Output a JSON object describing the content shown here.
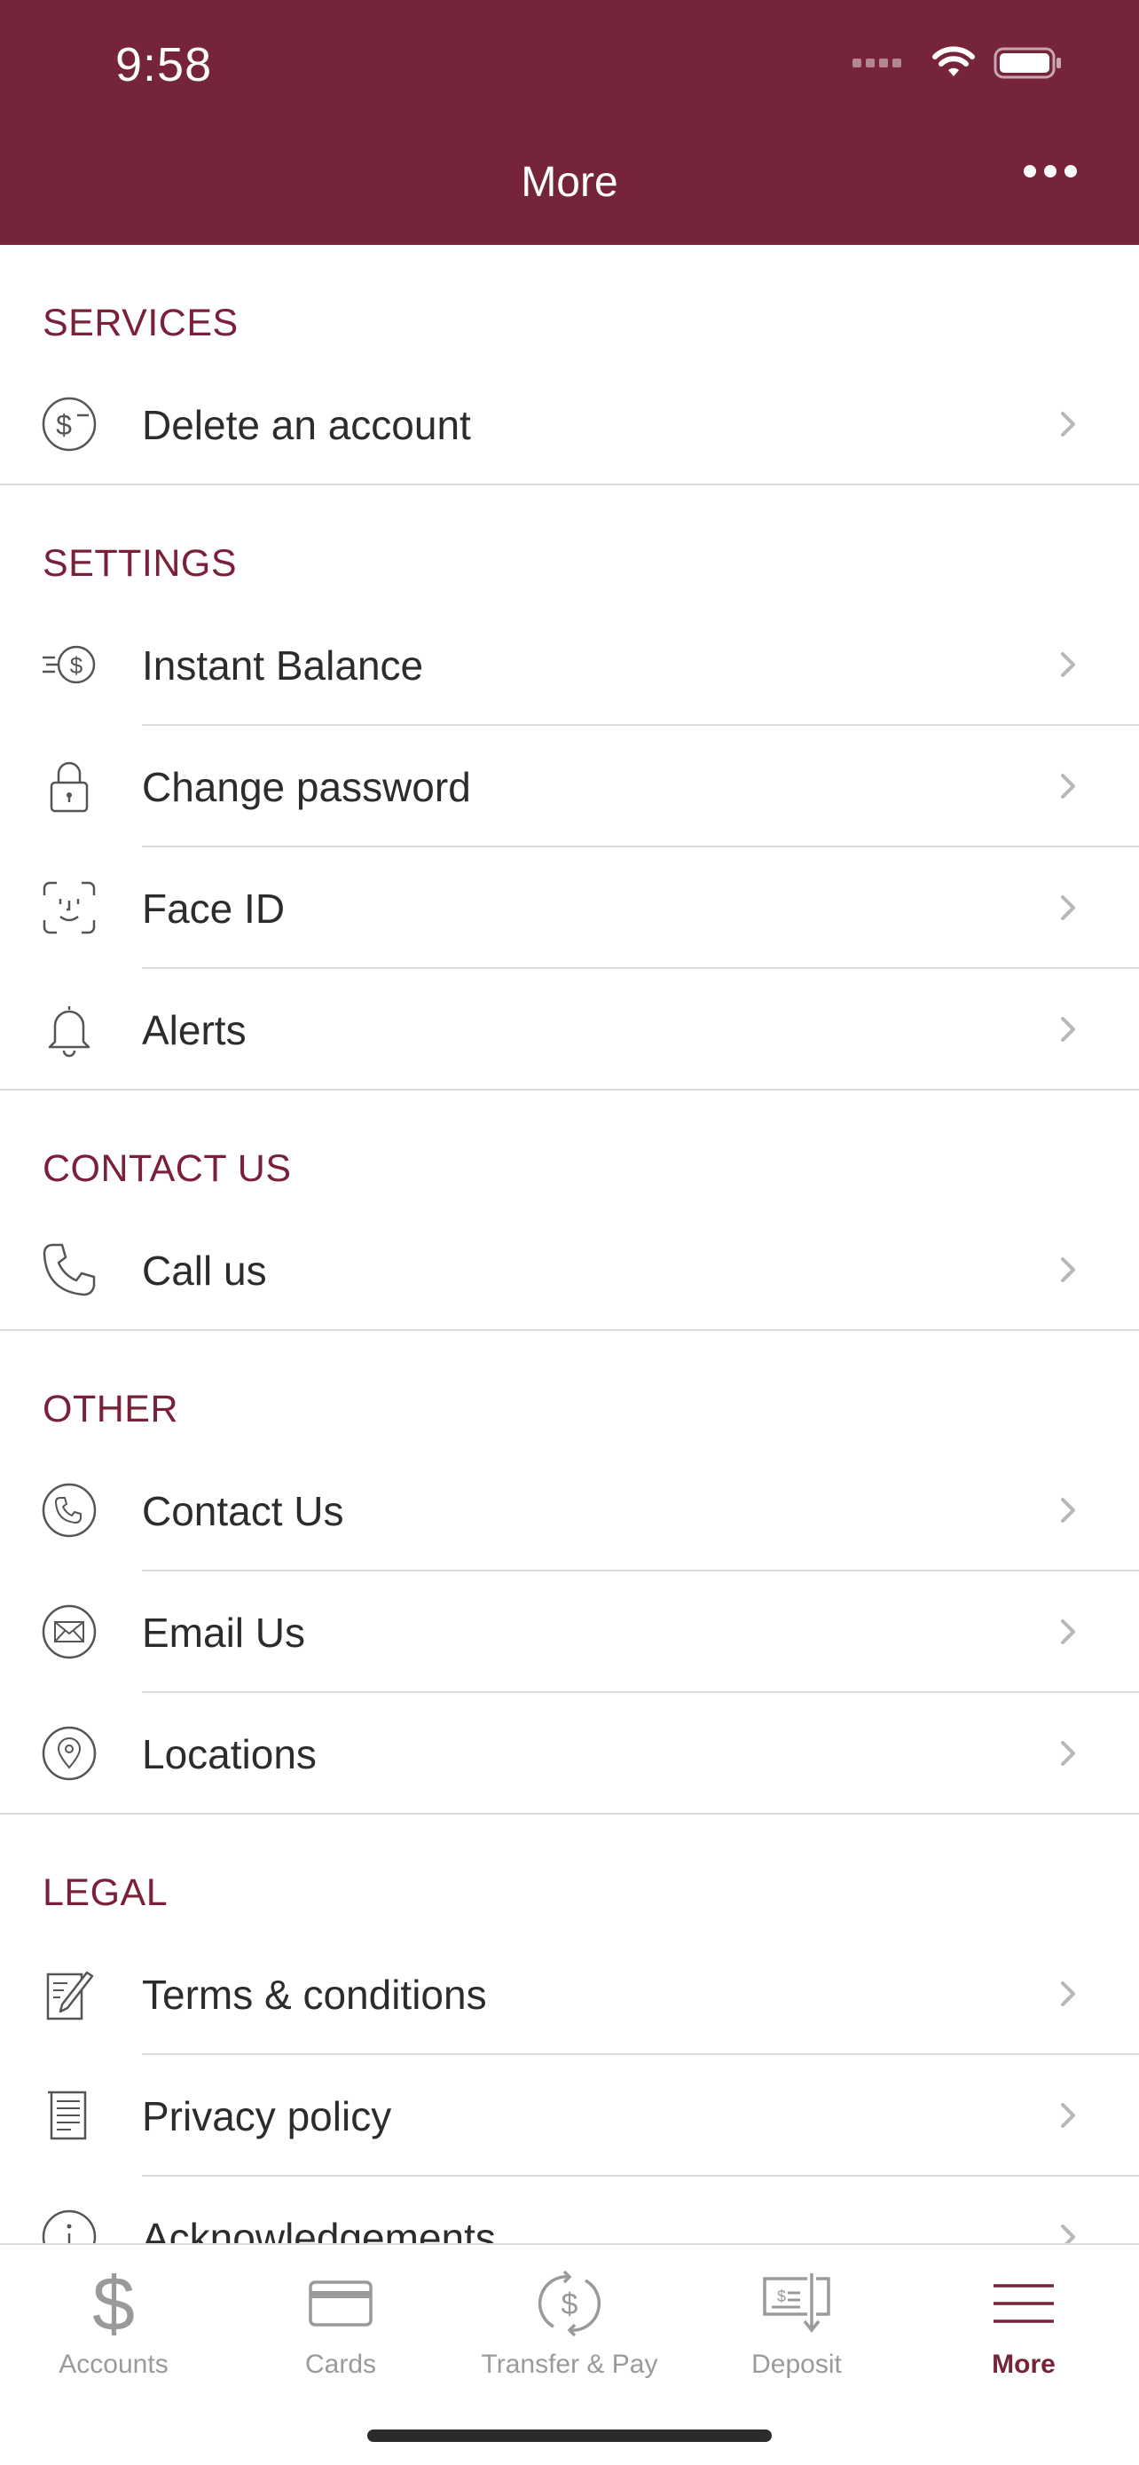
{
  "status": {
    "time": "9:58"
  },
  "header": {
    "title": "More"
  },
  "sections": [
    {
      "title": "SERVICES",
      "items": [
        {
          "label": "Delete an account",
          "icon": "dollar-minus-icon"
        }
      ]
    },
    {
      "title": "SETTINGS",
      "items": [
        {
          "label": "Instant Balance",
          "icon": "instant-balance-icon"
        },
        {
          "label": "Change password",
          "icon": "lock-icon"
        },
        {
          "label": "Face ID",
          "icon": "face-id-icon"
        },
        {
          "label": "Alerts",
          "icon": "bell-icon"
        }
      ]
    },
    {
      "title": "CONTACT US",
      "items": [
        {
          "label": "Call us",
          "icon": "phone-icon"
        }
      ]
    },
    {
      "title": "OTHER",
      "items": [
        {
          "label": "Contact Us",
          "icon": "phone-circle-icon"
        },
        {
          "label": "Email Us",
          "icon": "email-circle-icon"
        },
        {
          "label": "Locations",
          "icon": "location-circle-icon"
        }
      ]
    },
    {
      "title": "LEGAL",
      "items": [
        {
          "label": "Terms & conditions",
          "icon": "terms-icon"
        },
        {
          "label": "Privacy policy",
          "icon": "document-icon"
        },
        {
          "label": "Acknowledgements",
          "icon": "info-icon"
        }
      ]
    }
  ],
  "tabbar": {
    "items": [
      {
        "label": "Accounts",
        "icon": "dollar-icon"
      },
      {
        "label": "Cards",
        "icon": "card-icon"
      },
      {
        "label": "Transfer & Pay",
        "icon": "transfer-icon"
      },
      {
        "label": "Deposit",
        "icon": "deposit-icon"
      },
      {
        "label": "More",
        "icon": "menu-icon"
      }
    ]
  },
  "colors": {
    "brand": "#76243a",
    "section": "#7a2038",
    "inactive": "#9a9a9a"
  }
}
